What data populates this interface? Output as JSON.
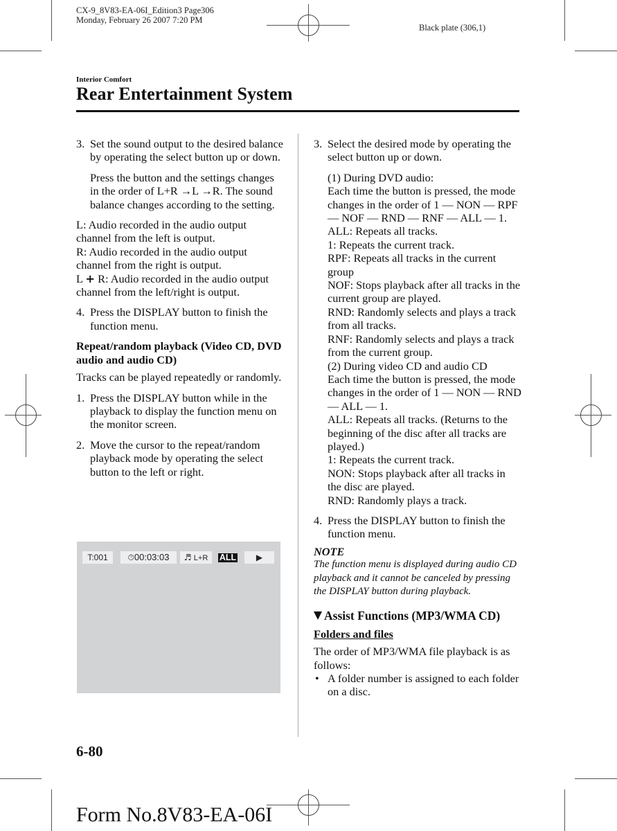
{
  "header": {
    "meta_line1": "CX-9_8V83-EA-06I_Edition3 Page306",
    "meta_line2": "Monday, February 26 2007 7:20 PM",
    "plate": "Black plate (306,1)",
    "section": "Interior Comfort",
    "title": "Rear Entertainment System"
  },
  "left": {
    "step3_num": "3.",
    "step3_text": "Set the sound output to the desired balance by operating the select button up or down.",
    "step3_sub": "Press the button and the settings changes in the order of L+R →L →R. The sound balance changes according to the setting.",
    "def_L": "L: Audio recorded in the audio output channel from the left is output.",
    "def_R": "R: Audio recorded in the audio output channel from the right is output.",
    "def_LR_prefix": "L",
    "def_LR_plus": "+",
    "def_LR_text": " R: Audio recorded in the audio output channel from the left/right is output.",
    "step4_num": "4.",
    "step4_text": "Press the DISPLAY button to finish the function menu.",
    "subhead": "Repeat/random playback (Video CD, DVD audio and audio CD)",
    "intro": "Tracks can be played repeatedly or randomly.",
    "step1_num": "1.",
    "step1_text": "Press the DISPLAY button while in the playback to display the function menu on the monitor screen.",
    "step2_num": "2.",
    "step2_text": "Move the cursor to the repeat/random playback mode by operating the select button to the left or right."
  },
  "screen": {
    "track": "T:001",
    "time": "00:03:03",
    "audio": "L+R",
    "mode": "ALL",
    "icons": [
      "clock-icon",
      "music-note-icon",
      "play-icon"
    ]
  },
  "right": {
    "step3_num": "3.",
    "step3_text": "Select the desired mode by operating the select button up or down.",
    "dvd_lines": [
      "(1) During DVD audio:",
      "Each time the button is pressed, the mode changes in the order of 1 — NON — RPF — NOF — RND — RNF — ALL — 1.",
      "ALL: Repeats all tracks.",
      "1: Repeats the current track.",
      "RPF: Repeats all tracks in the current group",
      "NOF: Stops playback after all tracks in the current group are played.",
      "RND: Randomly selects and plays a track from all tracks.",
      "RNF: Randomly selects and plays a track from the current group."
    ],
    "cd_lines": [
      "(2) During video CD and audio CD",
      "Each time the button is pressed, the mode changes in the order of 1 — NON — RND — ALL — 1.",
      "ALL: Repeats all tracks. (Returns to the beginning of the disc after all tracks are played.)",
      "1: Repeats the current track.",
      "NON: Stops playback after all tracks in the disc are played.",
      "RND: Randomly plays a track."
    ],
    "step4_num": "4.",
    "step4_text": "Press the DISPLAY button to finish the function menu.",
    "note_label": "NOTE",
    "note_text": "The function menu is displayed during audio CD playback and it cannot be canceled by pressing the DISPLAY button during playback.",
    "assist_heading": "Assist Functions (MP3/WMA CD)",
    "folders_heading": "Folders and files",
    "folders_intro": "The order of MP3/WMA file playback is as follows:",
    "bullet1": "A folder number is assigned to each folder on a disc."
  },
  "footer": {
    "page_number": "6-80",
    "form_number": "Form No.8V83-EA-06I"
  }
}
